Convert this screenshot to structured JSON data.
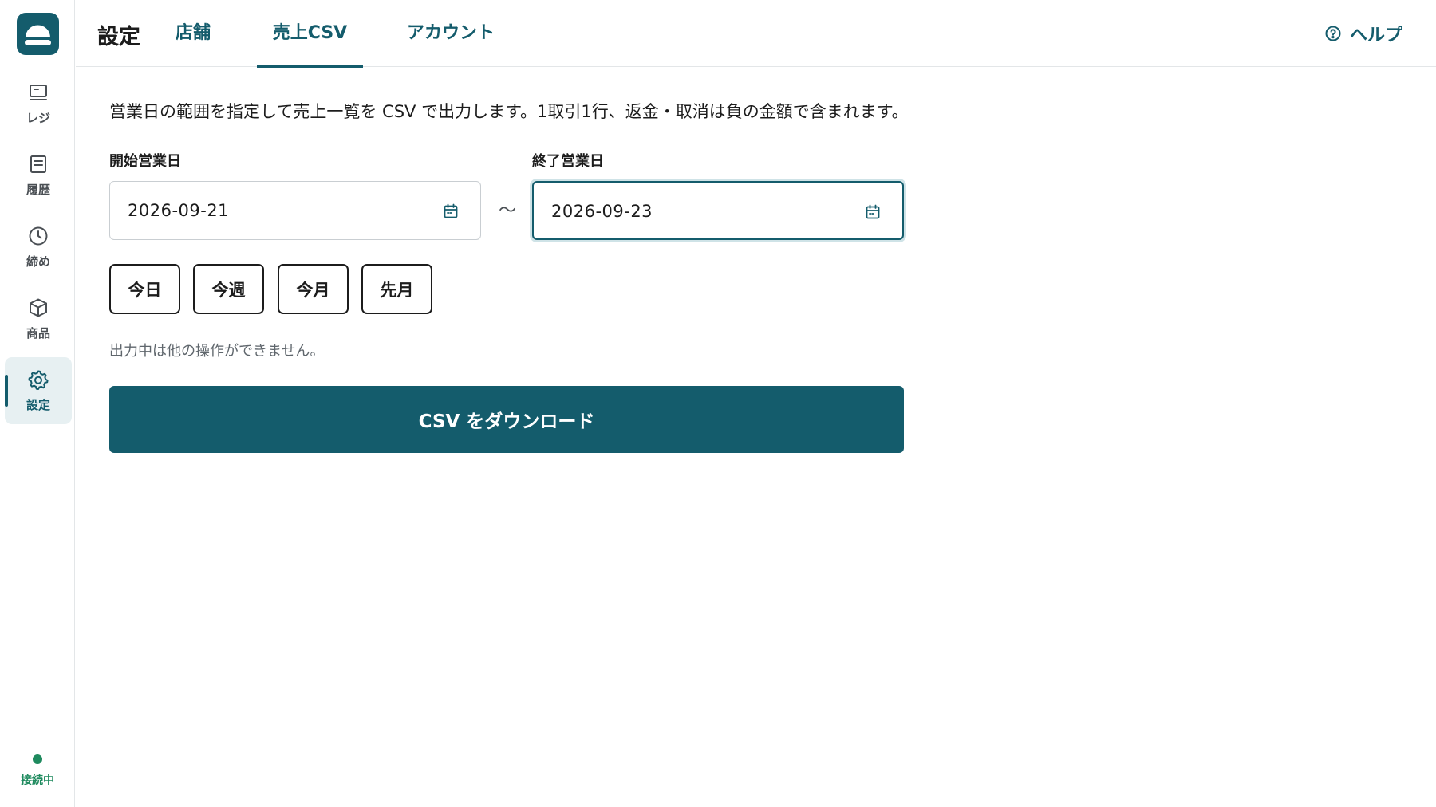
{
  "colors": {
    "brand": "#145c6c",
    "brand_light": "#e7f0f2",
    "online": "#1e8a5e",
    "border": "#c9ced2",
    "text": "#1c1c1c",
    "muted_text": "#5f666c"
  },
  "app": {
    "logo_icon": "app-logo-icon"
  },
  "sidebar": {
    "items": [
      {
        "label": "レジ",
        "icon": "register-icon",
        "active": false
      },
      {
        "label": "履歴",
        "icon": "history-icon",
        "active": false
      },
      {
        "label": "締め",
        "icon": "clock-icon",
        "active": false
      },
      {
        "label": "商品",
        "icon": "box-icon",
        "active": false
      },
      {
        "label": "設定",
        "icon": "gear-icon",
        "active": true
      }
    ],
    "status": {
      "label": "接続中",
      "icon": "status-dot-icon"
    }
  },
  "header": {
    "title": "設定",
    "tabs": [
      {
        "label": "店舗",
        "active": false
      },
      {
        "label": "売上CSV",
        "active": true
      },
      {
        "label": "アカウント",
        "active": false
      }
    ],
    "help": {
      "label": "ヘルプ",
      "icon": "help-circle-icon"
    }
  },
  "main": {
    "description": "営業日の範囲を指定して売上一覧を CSV で出力します。1取引1行、返金・取消は負の金額で含まれます。",
    "start_date": {
      "label": "開始営業日",
      "value": "2026-09-21",
      "icon": "calendar-icon"
    },
    "range_separator": "〜",
    "end_date": {
      "label": "終了営業日",
      "value": "2026-09-23",
      "icon": "calendar-icon",
      "focused": true
    },
    "presets": [
      "今日",
      "今週",
      "今月",
      "先月"
    ],
    "note": "出力中は他の操作ができません。",
    "download_button": "CSV をダウンロード"
  }
}
